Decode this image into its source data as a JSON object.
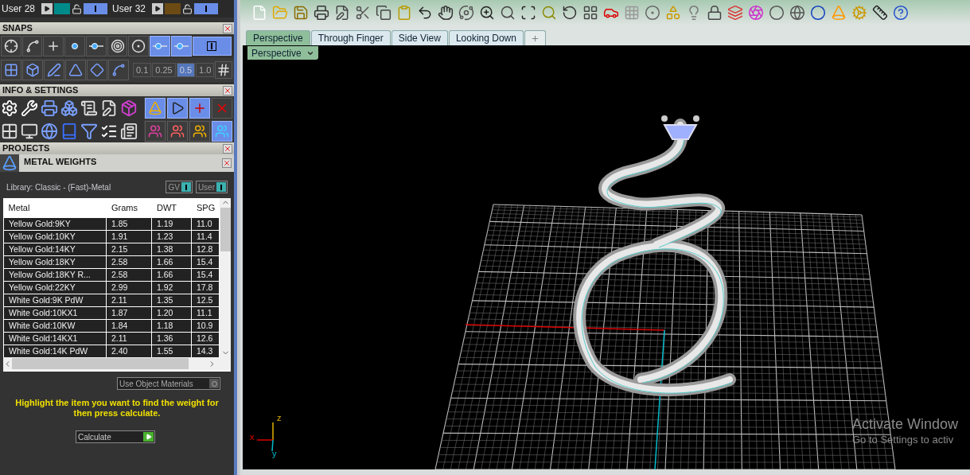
{
  "user_row": [
    {
      "label": "User 28",
      "color": "#008b8b",
      "on": true
    },
    {
      "label": "User 32",
      "color": "#6b4a14",
      "on": true
    }
  ],
  "snaps": {
    "title": "SNAPS",
    "buttons": [
      {
        "selected": false
      },
      {
        "selected": false
      },
      {
        "selected": false
      },
      {
        "selected": false
      },
      {
        "selected": false
      },
      {
        "selected": false
      },
      {
        "selected": false
      },
      {
        "selected": true
      },
      {
        "selected": true
      }
    ],
    "toggle_on": true,
    "tools": [
      {
        "selected": false
      },
      {
        "selected": false
      },
      {
        "selected": false
      },
      {
        "selected": false
      },
      {
        "selected": false
      },
      {
        "selected": false
      }
    ],
    "increments": [
      {
        "label": "0.1",
        "selected": false
      },
      {
        "label": "0.25",
        "selected": false
      },
      {
        "label": "0.5",
        "selected": true
      },
      {
        "label": "1.0",
        "selected": false
      }
    ]
  },
  "info_settings": {
    "title": "INFO & SETTINGS",
    "row_1": [
      {
        "selected": true
      },
      {
        "selected": true
      },
      {
        "selected": true
      },
      {
        "selected": false
      }
    ],
    "row_2": [
      {
        "selected": false
      },
      {
        "selected": false
      },
      {
        "selected": false
      },
      {
        "selected": true
      }
    ]
  },
  "projects": {
    "title": "PROJECTS"
  },
  "metal_weights": {
    "title": "METAL WEIGHTS",
    "library": "Library: Classic - (Fast)-Metal",
    "toggles": [
      {
        "label": "GV",
        "on": true
      },
      {
        "label": "User",
        "on": true
      }
    ],
    "table": {
      "columns": [
        "Metal",
        "Grams",
        "DWT",
        "SPG"
      ],
      "rows": [
        [
          "Yellow Gold:9KY",
          "1.85",
          "1.19",
          "11.0"
        ],
        [
          "Yellow Gold:10KY",
          "1.91",
          "1.23",
          "11.4"
        ],
        [
          "Yellow Gold:14KY",
          "2.15",
          "1.38",
          "12.8"
        ],
        [
          "Yellow Gold:18KY",
          "2.58",
          "1.66",
          "15.4"
        ],
        [
          "Yellow Gold:18KY R...",
          "2.58",
          "1.66",
          "15.4"
        ],
        [
          "Yellow Gold:22KY",
          "2.99",
          "1.92",
          "17.8"
        ],
        [
          "White Gold:9K PdW",
          "2.11",
          "1.35",
          "12.5"
        ],
        [
          "White Gold:10KX1",
          "1.87",
          "1.20",
          "11.1"
        ],
        [
          "White Gold:10KW",
          "1.84",
          "1.18",
          "10.9"
        ],
        [
          "White Gold:14KX1",
          "2.11",
          "1.36",
          "12.6"
        ],
        [
          "White Gold:14K PdW",
          "2.40",
          "1.55",
          "14.3"
        ]
      ]
    },
    "use_object_materials": {
      "label": "Use Object Materials",
      "on": false
    },
    "instruction": "Highlight the item you want to find the weight for then press calculate.",
    "calculate": "Calculate"
  },
  "tabs": [
    {
      "label": "Perspective",
      "selected": true
    },
    {
      "label": "Through Finger",
      "selected": false
    },
    {
      "label": "Side View",
      "selected": false
    },
    {
      "label": "Looking Down",
      "selected": false
    }
  ],
  "viewport": {
    "view_menu": "Perspective",
    "axes": {
      "z": "z",
      "x": "x",
      "y": "y"
    },
    "notice": {
      "title": "Activate Window",
      "subtitle": "Go to Settings to activ"
    }
  }
}
